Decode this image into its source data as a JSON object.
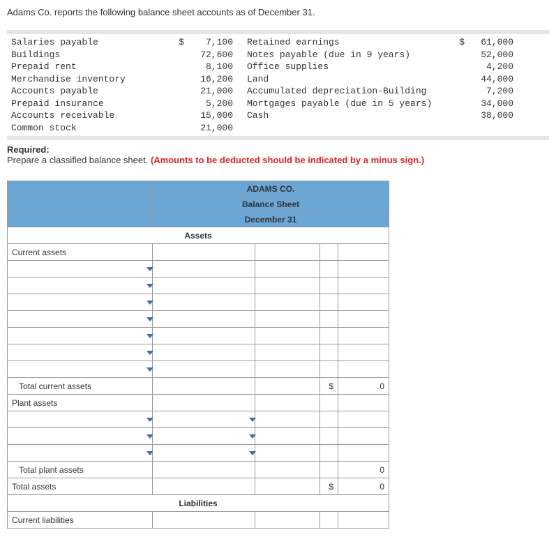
{
  "intro": "Adams Co. reports the following balance sheet accounts as of December 31.",
  "accounts_left": [
    {
      "label": "Salaries payable",
      "currency": "$",
      "value": "7,100"
    },
    {
      "label": "Buildings",
      "currency": "",
      "value": "72,600"
    },
    {
      "label": "Prepaid rent",
      "currency": "",
      "value": "8,100"
    },
    {
      "label": "Merchandise inventory",
      "currency": "",
      "value": "16,200"
    },
    {
      "label": "Accounts payable",
      "currency": "",
      "value": "21,000"
    },
    {
      "label": "Prepaid insurance",
      "currency": "",
      "value": "5,200"
    },
    {
      "label": "Accounts receivable",
      "currency": "",
      "value": "15,000"
    },
    {
      "label": "Common stock",
      "currency": "",
      "value": "21,000"
    }
  ],
  "accounts_right": [
    {
      "label": "Retained earnings",
      "currency": "$",
      "value": "61,000"
    },
    {
      "label": "Notes payable (due in 9 years)",
      "currency": "",
      "value": "52,000"
    },
    {
      "label": "Office supplies",
      "currency": "",
      "value": "4,200"
    },
    {
      "label": "Land",
      "currency": "",
      "value": "44,000"
    },
    {
      "label": "Accumulated depreciation-Building",
      "currency": "",
      "value": "7,200"
    },
    {
      "label": "Mortgages payable (due in 5 years)",
      "currency": "",
      "value": "34,000"
    },
    {
      "label": "Cash",
      "currency": "",
      "value": "38,000"
    }
  ],
  "required_label": "Required:",
  "required_text": "Prepare a classified balance sheet. ",
  "required_note": "(Amounts to be deducted should be indicated by a minus sign.)",
  "sheet": {
    "company": "ADAMS CO.",
    "title": "Balance Sheet",
    "date": "December 31",
    "assets_hdr": "Assets",
    "current_assets": "Current assets",
    "total_current_assets": "Total current assets",
    "tca_currency": "$",
    "tca_value": "0",
    "plant_assets": "Plant assets",
    "total_plant_assets": "Total plant assets",
    "tpa_value": "0",
    "total_assets": "Total assets",
    "ta_currency": "$",
    "ta_value": "0",
    "liabilities_hdr": "Liabilities",
    "current_liabilities": "Current liabilities"
  }
}
